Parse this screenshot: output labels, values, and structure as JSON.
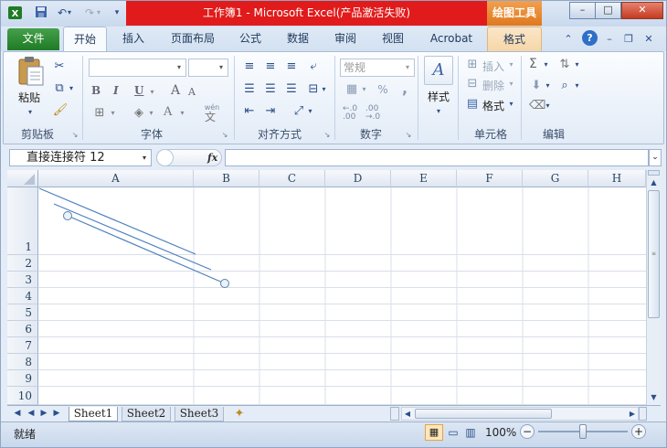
{
  "title": "工作簿1 - Microsoft Excel(产品激活失败)",
  "context_tab_title": "绘图工具",
  "window_buttons": {
    "minimize": "–",
    "maximize": "□",
    "close": "✕"
  },
  "tabs": {
    "file": "文件",
    "items": [
      "开始",
      "插入",
      "页面布局",
      "公式",
      "数据",
      "审阅",
      "视图",
      "Acrobat",
      "格式"
    ]
  },
  "ribbon": {
    "clipboard": {
      "paste": "粘贴",
      "label": "剪贴板"
    },
    "font": {
      "label": "字体",
      "bold": "B",
      "italic": "I",
      "underline": "U",
      "grow": "A",
      "shrink": "A",
      "font_color": "A",
      "phonetic": "wén"
    },
    "alignment": {
      "label": "对齐方式"
    },
    "number": {
      "format_value": "常规",
      "percent": "%",
      "comma": ",",
      "label": "数字"
    },
    "styles": {
      "label": "样式"
    },
    "cells": {
      "insert": "插入",
      "delete": "删除",
      "format": "格式",
      "label": "单元格"
    },
    "editing": {
      "label": "编辑",
      "sum": "Σ"
    }
  },
  "formula_bar": {
    "name_box": "直接连接符 12",
    "fx": "fx",
    "formula": ""
  },
  "columns": [
    "A",
    "B",
    "C",
    "D",
    "E",
    "F",
    "G",
    "H"
  ],
  "rows": [
    "1",
    "2",
    "3",
    "4",
    "5",
    "6",
    "7",
    "8",
    "9",
    "10"
  ],
  "sheets": [
    "Sheet1",
    "Sheet2",
    "Sheet3"
  ],
  "status": {
    "ready": "就绪",
    "zoom": "100%"
  },
  "colors": {
    "title_red": "#e11b1b",
    "file_green": "#2e8b34",
    "context_orange": "#f0963f",
    "line_blue": "#4f81bd"
  }
}
